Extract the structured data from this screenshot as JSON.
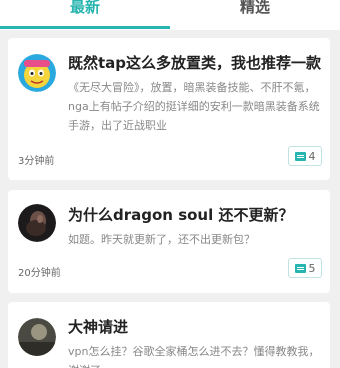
{
  "tabs": [
    {
      "label": "最新",
      "active": true
    },
    {
      "label": "精选",
      "active": false
    }
  ],
  "posts": [
    {
      "title": "既然tap这么多放置类，我也推荐一款",
      "excerpt": "《无尽大冒险》，放置，暗黑装备技能、不肝不氪，nga上有帖子介绍的挺详细的安利一款暗黑装备系统手游，出了近战职业",
      "time": "3分钟前",
      "comments": "4"
    },
    {
      "title": "为什么dragon soul 还不更新？",
      "excerpt": "如题。昨天就更新了，还不出更新包？",
      "time": "20分钟前",
      "comments": "5"
    },
    {
      "title": "大神请进",
      "excerpt": "vpn怎么挂？谷歌全家桶怎么进不去？懂得教教我，谢谢了"
    }
  ],
  "colors": {
    "accent": "#27b5b0"
  }
}
